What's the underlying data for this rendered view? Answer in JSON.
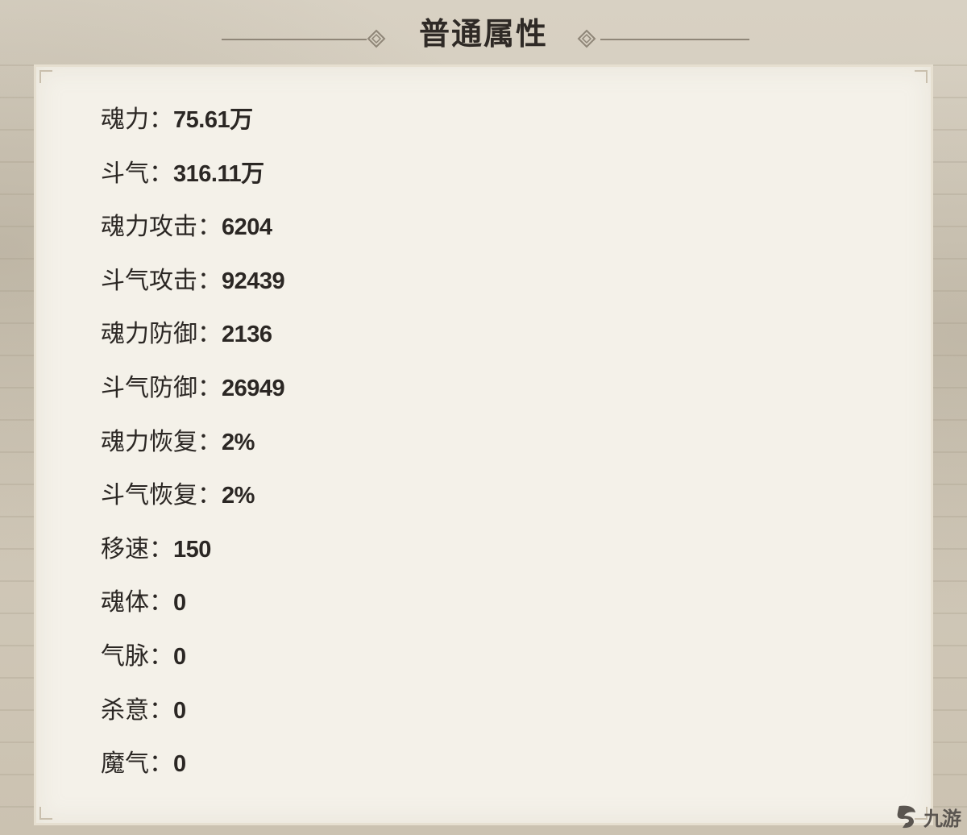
{
  "header": {
    "title": "普通属性"
  },
  "stats": [
    {
      "label": "魂力",
      "sep": "：",
      "value": "75.61万"
    },
    {
      "label": "斗气",
      "sep": "：",
      "value": "316.11万"
    },
    {
      "label": "魂力攻击",
      "sep": "：",
      "value": "6204"
    },
    {
      "label": "斗气攻击",
      "sep": "：",
      "value": "92439"
    },
    {
      "label": "魂力防御",
      "sep": "：",
      "value": "2136"
    },
    {
      "label": "斗气防御",
      "sep": "：",
      "value": "26949"
    },
    {
      "label": "魂力恢复",
      "sep": "：",
      "value": "2%"
    },
    {
      "label": "斗气恢复",
      "sep": "：",
      "value": "2%"
    },
    {
      "label": "移速",
      "sep": "：",
      "value": "150"
    },
    {
      "label": "魂体",
      "sep": "：",
      "value": "0"
    },
    {
      "label": "气脉",
      "sep": "：",
      "value": "0"
    },
    {
      "label": "杀意",
      "sep": "：",
      "value": "0"
    },
    {
      "label": "魔气",
      "sep": "：",
      "value": "0"
    }
  ],
  "watermark": {
    "text": "九游",
    "icon": "jiuyou-logo-icon"
  }
}
